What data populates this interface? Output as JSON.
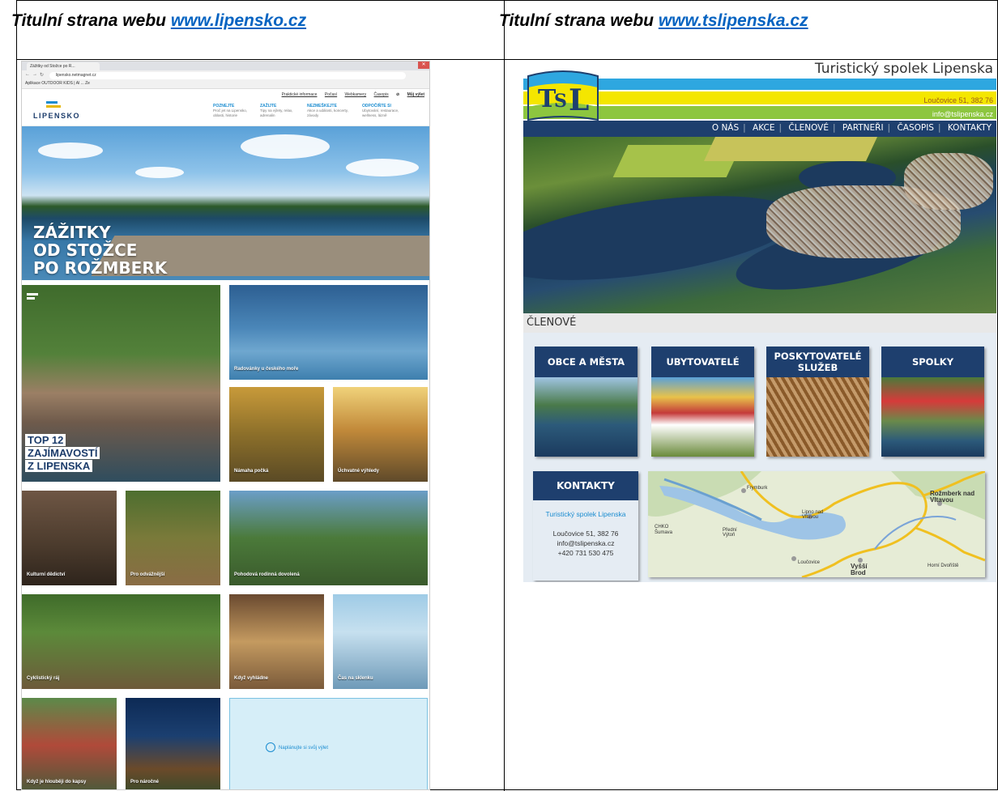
{
  "headings": {
    "left": {
      "prefix": "Titulní strana webu ",
      "link": "www.lipensko.cz"
    },
    "right": {
      "prefix": "Titulní strana webu ",
      "link": "www.tslipenska.cz"
    }
  },
  "lipensko": {
    "browser": {
      "tab_title": "Zážitky od Stožce po R...",
      "url": "lipensko.netmagnet.cz",
      "bookmarks": "Aplikace   OUTDOOR KIDS | Al ...   Ze"
    },
    "logo_text": "LIPENSKO",
    "top_links": [
      "Praktické informace",
      "Počasí",
      "Webkamery",
      "Časopis"
    ],
    "plan_link": "Můj výlet",
    "menu": [
      {
        "title": "POZNEJTE",
        "text": "Proč jet na Lipensko, oblasti, historie"
      },
      {
        "title": "ZAŽIJTE",
        "text": "Tipy na výlety, relax, adrenalin"
      },
      {
        "title": "NEZMEŠKEJTE",
        "text": "Akce a události, koncerty, závody"
      },
      {
        "title": "ODPOČIŇTE SI",
        "text": "Ubytování, restaurace, wellness, lázně"
      }
    ],
    "hero_title": [
      "ZÁŽITKY",
      "OD STOŽCE",
      "PO ROŽMBERK"
    ],
    "top12": [
      "TOP 12",
      "ZAJÍMAVOSTÍ",
      "Z LIPENSKA"
    ],
    "tiles": {
      "radovanky": "Radovánky u českého moře",
      "namaha": "Námaha počká",
      "uchvatne": "Úchvatné výhledy",
      "kulturni": "Kulturní dědictví",
      "odvaznejsi": "Pro odvážnější",
      "pohodova": "Pohodová rodinná dovolená",
      "cyklisticky": "Cyklistický ráj",
      "vyhladne": "Když vyhládne",
      "cas": "Čas na sklenku",
      "hloubeji": "Když je hlouběji do kapsy",
      "narocne": "Pro náročné",
      "planujte": "Naplánujte si svůj výlet"
    }
  },
  "tslipenska": {
    "site_title": "Turistický spolek Lipenska",
    "address": "Loučovice 51, 382 76",
    "email": "info@tslipenska.cz",
    "nav": [
      "O NÁS",
      "AKCE",
      "ČLENOVÉ",
      "PARTNEŘI",
      "ČASOPIS",
      "KONTAKTY"
    ],
    "section_title": "ČLENOVÉ",
    "cards": [
      "OBCE A MĚSTA",
      "UBYTOVATELÉ",
      "POSKYTOVATELÉ SLUŽEB",
      "SPOLKY"
    ],
    "contacts": {
      "title": "KONTAKTY",
      "org": "Turistický spolek Lipenska",
      "address": "Loučovice 51, 382 76",
      "email": "info@tslipenska.cz",
      "phone": "+420 731 530 475"
    },
    "map_labels": [
      "Frymburk",
      "Lipno nad Vltavou",
      "Přední Výtoň",
      "CHKO Šumava",
      "Loučovice",
      "Vyšší Brod",
      "Rožmberk nad Vltavou",
      "Horní Dvořiště"
    ]
  }
}
